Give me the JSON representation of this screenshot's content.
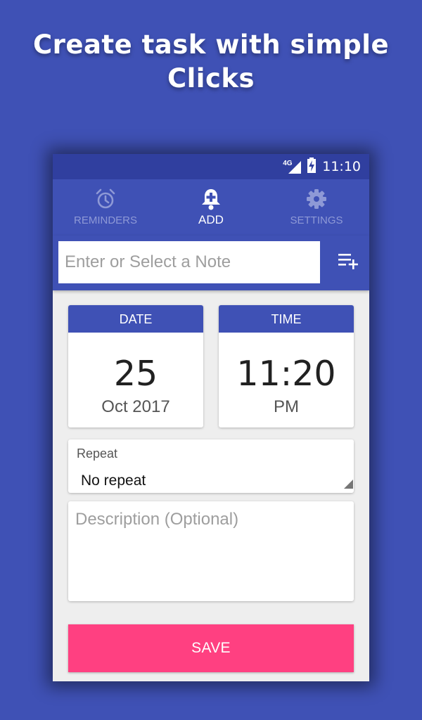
{
  "headline": {
    "line1": "Create task with simple",
    "line2": "Clicks"
  },
  "status_bar": {
    "network": "4G",
    "time": "11:10"
  },
  "tabs": [
    {
      "label": "REMINDERS",
      "icon": "alarm-clock-icon",
      "active": false
    },
    {
      "label": "ADD",
      "icon": "bell-plus-icon",
      "active": true
    },
    {
      "label": "SETTINGS",
      "icon": "gear-icon",
      "active": false
    }
  ],
  "note": {
    "placeholder": "Enter or Select a Note",
    "value": "",
    "add_icon": "playlist-add-icon"
  },
  "date": {
    "header": "DATE",
    "day": "25",
    "month_year": "Oct 2017"
  },
  "time": {
    "header": "TIME",
    "clock": "11:20",
    "period": "PM"
  },
  "repeat": {
    "label": "Repeat",
    "value": "No repeat"
  },
  "description": {
    "placeholder": "Description (Optional)",
    "value": ""
  },
  "save_label": "SAVE",
  "colors": {
    "background": "#3f51b5",
    "status_bar": "#303f9f",
    "primary": "#3f51b5",
    "inactive_tab": "#8e99d6",
    "accent": "#ff4081",
    "surface": "#eeeeee"
  }
}
